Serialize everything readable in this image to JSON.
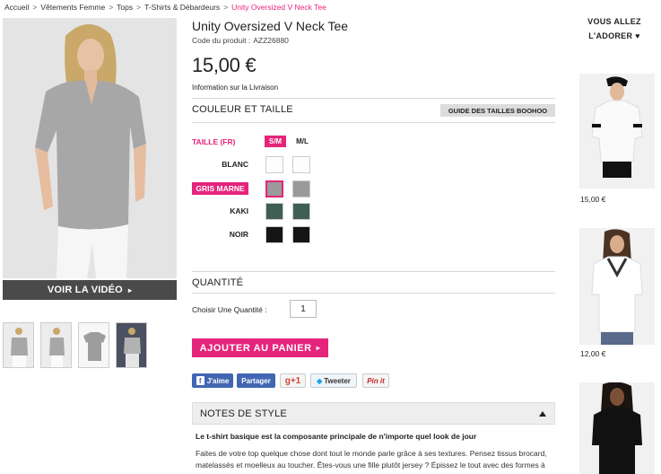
{
  "breadcrumb": [
    "Accueil",
    "Vêtements Femme",
    "Tops",
    "T-Shirts & Débardeurs",
    "Unity Oversized V Neck Tee"
  ],
  "product": {
    "title": "Unity Oversized V Neck Tee",
    "code_label": "Code du produit :",
    "code": "AZZ26880",
    "price": "15,00 €",
    "delivery_link": "Information sur la Livraison"
  },
  "video_label": "VOIR LA VIDÉO",
  "video_arrow": "▸",
  "color_size": {
    "section_title": "COULEUR ET TAILLE",
    "guide_button": "GUIDE DES TAILLES BOOHOO",
    "size_label": "TAILLE (FR)",
    "sizes": [
      "S/M",
      "M/L"
    ],
    "selected_size": "S/M",
    "colors": [
      {
        "name": "BLANC",
        "hex": "#ffffff"
      },
      {
        "name": "GRIS MARNE",
        "hex": "#9a9a9a"
      },
      {
        "name": "KAKI",
        "hex": "#3f5f53"
      },
      {
        "name": "NOIR",
        "hex": "#151515"
      }
    ],
    "selected_color": "GRIS MARNE"
  },
  "quantity": {
    "section_title": "QUANTITÉ",
    "label": "Choisir Une Quantité :",
    "value": "1"
  },
  "add_to_cart": "AJOUTER AU PANIER",
  "add_to_cart_arrow": "▸",
  "social": {
    "fb_like": "J'aime",
    "fb_share": "Partager",
    "gplus": "g+1",
    "tweet": "Tweeter",
    "pin": "Pin it"
  },
  "notes": {
    "title": "NOTES DE STYLE",
    "heading": "Le t-shirt basique est la composante principale de n'importe quel look de jour",
    "body": "Faites de votre top quelque chose dont tout le monde parle grâce à ses textures. Pensez tissus brocard, matelassés et moelleux au toucher. Êtes-vous une fille plutôt jersey ? Épissez le tout avec des formes à la coupe décontractée et sarde dans des coloris sombres..."
  },
  "rail": {
    "title_line1": "VOUS ALLEZ",
    "title_line2": "L'ADORER ♥",
    "items": [
      {
        "price": "15,00 €"
      },
      {
        "price": "12,00 €"
      }
    ]
  },
  "colors": {
    "accent": "#e5247c",
    "facebook": "#4267b2"
  }
}
